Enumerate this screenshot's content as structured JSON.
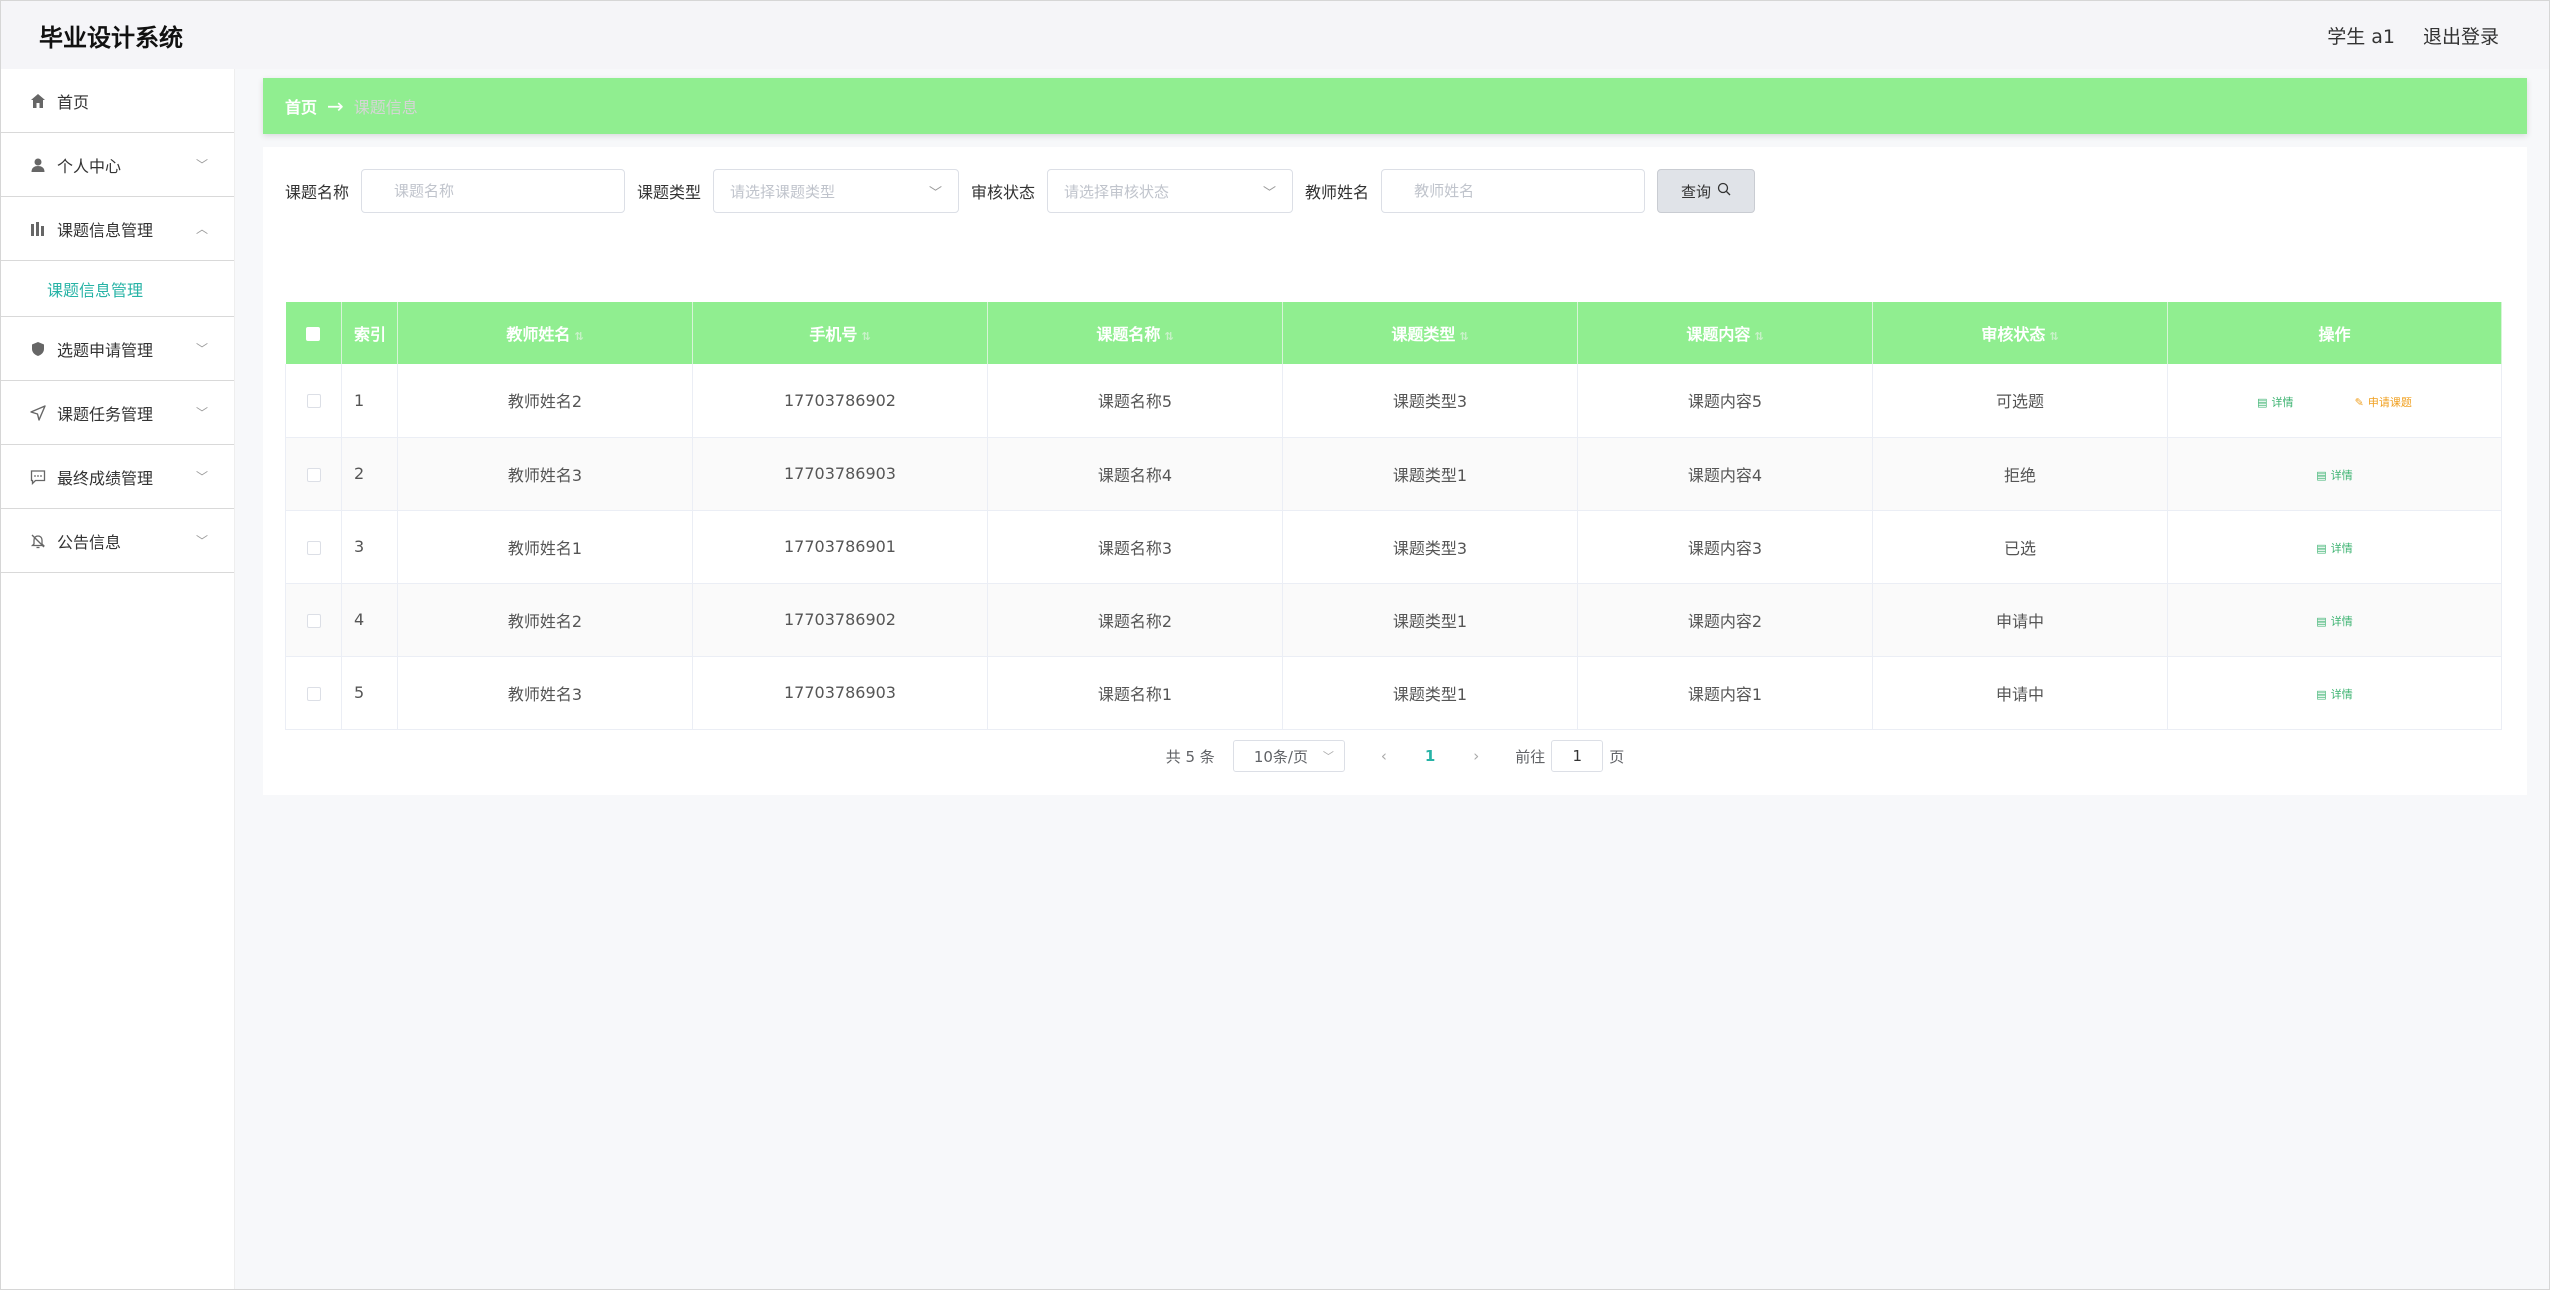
{
  "header": {
    "title": "毕业设计系统",
    "user": "学生 a1",
    "logout": "退出登录"
  },
  "sidebar": {
    "items": [
      {
        "label": "首页",
        "icon": "home-icon"
      },
      {
        "label": "个人中心",
        "icon": "user-icon"
      },
      {
        "label": "课题信息管理",
        "icon": "chart-icon"
      },
      {
        "label": "选题申请管理",
        "icon": "shield-icon"
      },
      {
        "label": "课题任务管理",
        "icon": "send-icon"
      },
      {
        "label": "最终成绩管理",
        "icon": "message-icon"
      },
      {
        "label": "公告信息",
        "icon": "bell-off-icon"
      }
    ],
    "submenu": "课题信息管理"
  },
  "breadcrumb": {
    "home": "首页",
    "arrow": "→",
    "current": "课题信息"
  },
  "search": {
    "topic_name_label": "课题名称",
    "topic_name_placeholder": "课题名称",
    "topic_type_label": "课题类型",
    "topic_type_placeholder": "请选择课题类型",
    "status_label": "审核状态",
    "status_placeholder": "请选择审核状态",
    "teacher_label": "教师姓名",
    "teacher_placeholder": "教师姓名",
    "query_button": "查询"
  },
  "table": {
    "headers": [
      "索引",
      "教师姓名",
      "手机号",
      "课题名称",
      "课题类型",
      "课题内容",
      "审核状态",
      "操作"
    ],
    "rows": [
      {
        "index": "1",
        "teacher": "教师姓名2",
        "phone": "17703786902",
        "topic": "课题名称5",
        "type": "课题类型3",
        "content": "课题内容5",
        "status": "可选题",
        "detail": "详情",
        "apply": "申请课题"
      },
      {
        "index": "2",
        "teacher": "教师姓名3",
        "phone": "17703786903",
        "topic": "课题名称4",
        "type": "课题类型1",
        "content": "课题内容4",
        "status": "拒绝",
        "detail": "详情"
      },
      {
        "index": "3",
        "teacher": "教师姓名1",
        "phone": "17703786901",
        "topic": "课题名称3",
        "type": "课题类型3",
        "content": "课题内容3",
        "status": "已选",
        "detail": "详情"
      },
      {
        "index": "4",
        "teacher": "教师姓名2",
        "phone": "17703786902",
        "topic": "课题名称2",
        "type": "课题类型1",
        "content": "课题内容2",
        "status": "申请中",
        "detail": "详情"
      },
      {
        "index": "5",
        "teacher": "教师姓名3",
        "phone": "17703786903",
        "topic": "课题名称1",
        "type": "课题类型1",
        "content": "课题内容1",
        "status": "申请中",
        "detail": "详情"
      }
    ]
  },
  "pagination": {
    "total": "共 5 条",
    "page_size": "10条/页",
    "current_page": "1",
    "goto_label": "前往",
    "goto_value": "1",
    "page_suffix": "页"
  },
  "colors": {
    "accent_green": "#90ee90",
    "active_teal": "#27b3a6",
    "detail_green": "#3cb371",
    "apply_orange": "#f0a020"
  }
}
